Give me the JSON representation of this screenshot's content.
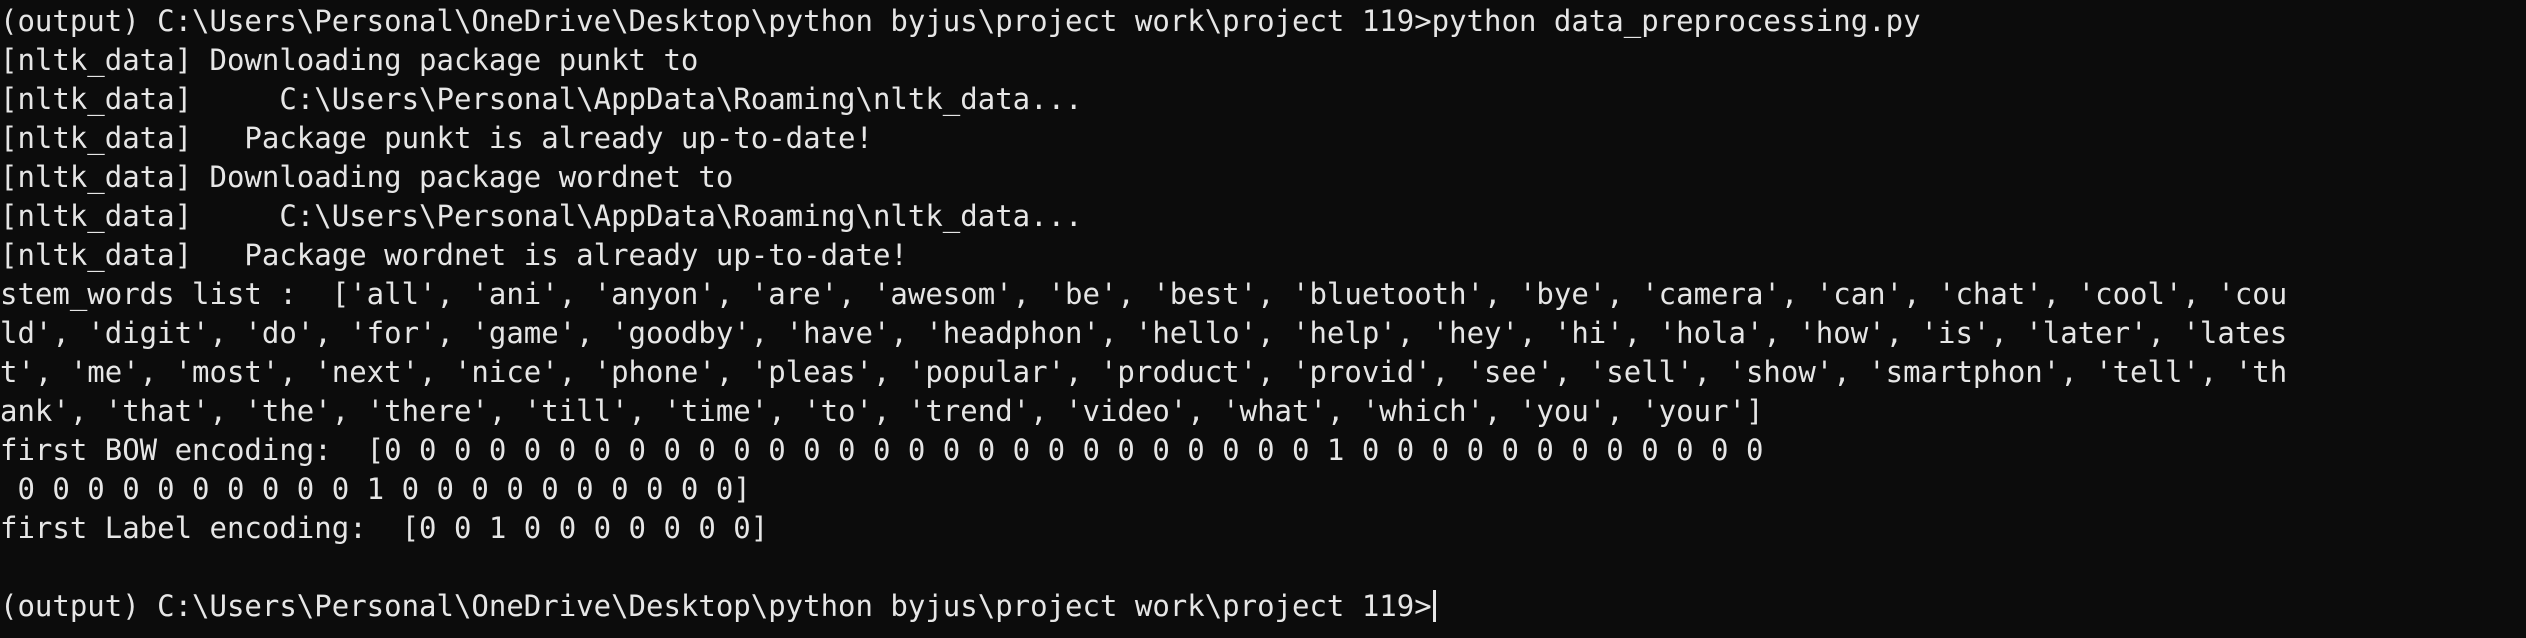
{
  "terminal": {
    "lines": [
      "(output) C:\\Users\\Personal\\OneDrive\\Desktop\\python byjus\\project work\\project 119>python data_preprocessing.py",
      "[nltk_data] Downloading package punkt to",
      "[nltk_data]     C:\\Users\\Personal\\AppData\\Roaming\\nltk_data...",
      "[nltk_data]   Package punkt is already up-to-date!",
      "[nltk_data] Downloading package wordnet to",
      "[nltk_data]     C:\\Users\\Personal\\AppData\\Roaming\\nltk_data...",
      "[nltk_data]   Package wordnet is already up-to-date!",
      "stem_words list :  ['all', 'ani', 'anyon', 'are', 'awesom', 'be', 'best', 'bluetooth', 'bye', 'camera', 'can', 'chat', 'cool', 'cou",
      "ld', 'digit', 'do', 'for', 'game', 'goodby', 'have', 'headphon', 'hello', 'help', 'hey', 'hi', 'hola', 'how', 'is', 'later', 'lates",
      "t', 'me', 'most', 'next', 'nice', 'phone', 'pleas', 'popular', 'product', 'provid', 'see', 'sell', 'show', 'smartphon', 'tell', 'th",
      "ank', 'that', 'the', 'there', 'till', 'time', 'to', 'trend', 'video', 'what', 'which', 'you', 'your']",
      "first BOW encoding:  [0 0 0 0 0 0 0 0 0 0 0 0 0 0 0 0 0 0 0 0 0 0 0 0 0 0 0 1 0 0 0 0 0 0 0 0 0 0 0 0",
      " 0 0 0 0 0 0 0 0 0 0 1 0 0 0 0 0 0 0 0 0 0]",
      "first Label encoding:  [0 0 1 0 0 0 0 0 0 0]",
      "",
      "(output) C:\\Users\\Personal\\OneDrive\\Desktop\\python byjus\\project work\\project 119>"
    ]
  }
}
